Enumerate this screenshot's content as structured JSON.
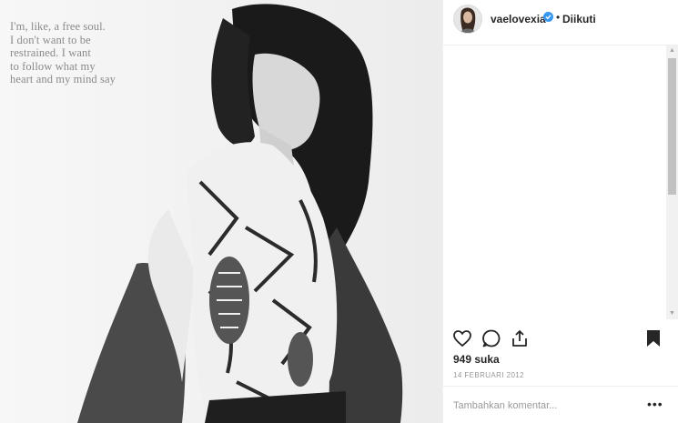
{
  "post": {
    "image_alt": "Black and white portrait of a woman wearing a patterned scarf",
    "quote_text": "I'm, like, a free soul.\nI don't want to be\nrestrained. I want\nto follow what my\nheart and my mind say"
  },
  "header": {
    "username": "vaelovexia",
    "verified_icon": "verified-badge-icon",
    "separator": "•",
    "follow_label": "Diikuti"
  },
  "actions": {
    "like_icon": "heart-icon",
    "comment_icon": "comment-icon",
    "share_icon": "share-icon",
    "save_icon": "bookmark-icon"
  },
  "stats": {
    "likes": "949 suka",
    "date": "14 FEBRUARI 2012"
  },
  "comment": {
    "placeholder": "Tambahkan komentar...",
    "more_label": "•••"
  },
  "colors": {
    "text": "#262626",
    "muted": "#999999",
    "verified": "#3897f0",
    "border": "#efefef"
  }
}
